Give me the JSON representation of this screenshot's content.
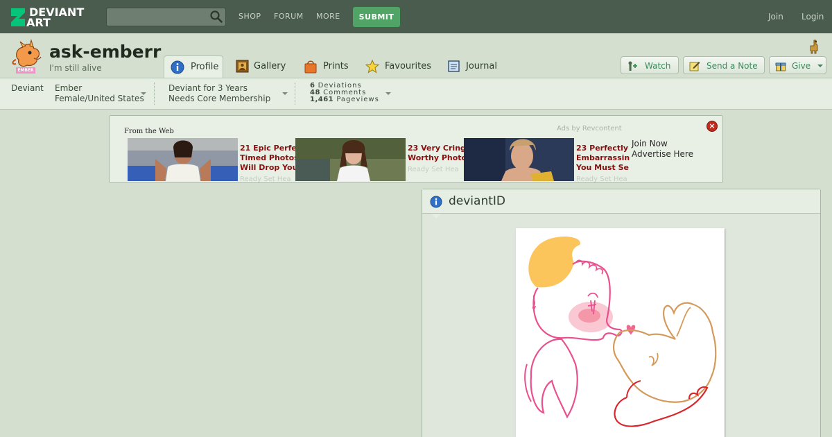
{
  "topbar": {
    "logo_line1": "DEVIANT",
    "logo_line2": "ART",
    "search_placeholder": "",
    "nav": [
      "SHOP",
      "FORUM",
      "MORE"
    ],
    "submit_label": "SUBMIT",
    "join_label": "Join",
    "login_label": "Login"
  },
  "profile": {
    "username": "ask-emberr",
    "tagline": "I'm still alive",
    "avatar_badge": "EMBER",
    "tabs": [
      {
        "label": "Profile",
        "icon": "info-icon",
        "active": true
      },
      {
        "label": "Gallery",
        "icon": "gallery-icon",
        "active": false
      },
      {
        "label": "Prints",
        "icon": "prints-bag-icon",
        "active": false
      },
      {
        "label": "Favourites",
        "icon": "star-icon",
        "active": false
      },
      {
        "label": "Journal",
        "icon": "journal-icon",
        "active": false
      }
    ],
    "actions": {
      "watch": "Watch",
      "note": "Send a Note",
      "give": "Give"
    }
  },
  "info": {
    "type": "Deviant",
    "name": "Ember",
    "gender_location": "Female/United States",
    "member_for": "Deviant for 3 Years",
    "membership": "Needs Core Membership",
    "stats": [
      {
        "value": "6",
        "label": "Deviations"
      },
      {
        "value": "48",
        "label": "Comments"
      },
      {
        "value": "1,461",
        "label": "Pageviews"
      }
    ]
  },
  "ad": {
    "from": "From the Web",
    "by": "Ads by Revcontent",
    "items": [
      {
        "title": [
          "21 Epic Perfe",
          "Timed Photos",
          "Will Drop You"
        ],
        "source": "Ready Set Hea"
      },
      {
        "title": [
          "23 Very Cring",
          "Worthy Photo"
        ],
        "source": "Ready Set Hea"
      },
      {
        "title": [
          "23 Perfectly",
          "Embarrassin",
          "You Must Se"
        ],
        "source": "Ready Set Hea"
      }
    ],
    "right_line1": "Join Now",
    "right_line2": "Advertise Here"
  },
  "deviantid": {
    "title": "deviantID"
  },
  "colors": {
    "topbar": "#4a5c4d",
    "submit": "#4fa466",
    "page_bg": "#d4dfd0",
    "ad_title": "#8a0f0f"
  }
}
